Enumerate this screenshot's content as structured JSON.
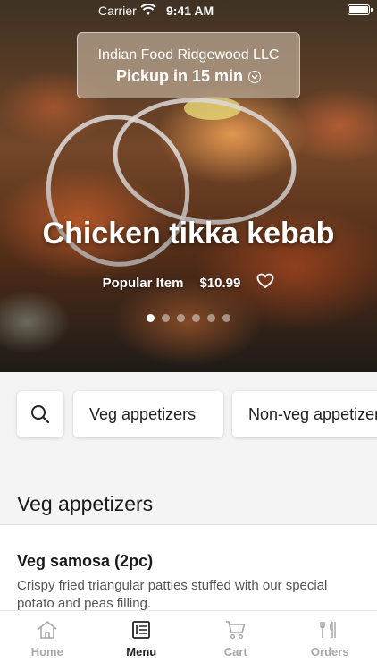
{
  "status_bar": {
    "carrier": "Carrier",
    "time": "9:41 AM"
  },
  "store": {
    "name": "Indian Food Ridgewood LLC",
    "pickup": "Pickup in 15 min"
  },
  "hero": {
    "dish_title": "Chicken tikka kebab",
    "badge": "Popular Item",
    "price": "$10.99",
    "carousel": {
      "count": 6,
      "active_index": 0
    }
  },
  "categories": [
    "Veg appetizers",
    "Non-veg appetizers"
  ],
  "section": {
    "title": "Veg appetizers"
  },
  "items": [
    {
      "name": "Veg samosa (2pc)",
      "description": "Crispy fried triangular patties stuffed with our special potato and peas filling."
    }
  ],
  "tabs": [
    {
      "label": "Home",
      "icon": "home-icon",
      "active": false
    },
    {
      "label": "Menu",
      "icon": "menu-icon",
      "active": true
    },
    {
      "label": "Cart",
      "icon": "cart-icon",
      "active": false
    },
    {
      "label": "Orders",
      "icon": "orders-icon",
      "active": false
    }
  ],
  "colors": {
    "tab_active": "#222222",
    "tab_inactive": "#a8a8a8",
    "background": "#f4f4f4"
  }
}
